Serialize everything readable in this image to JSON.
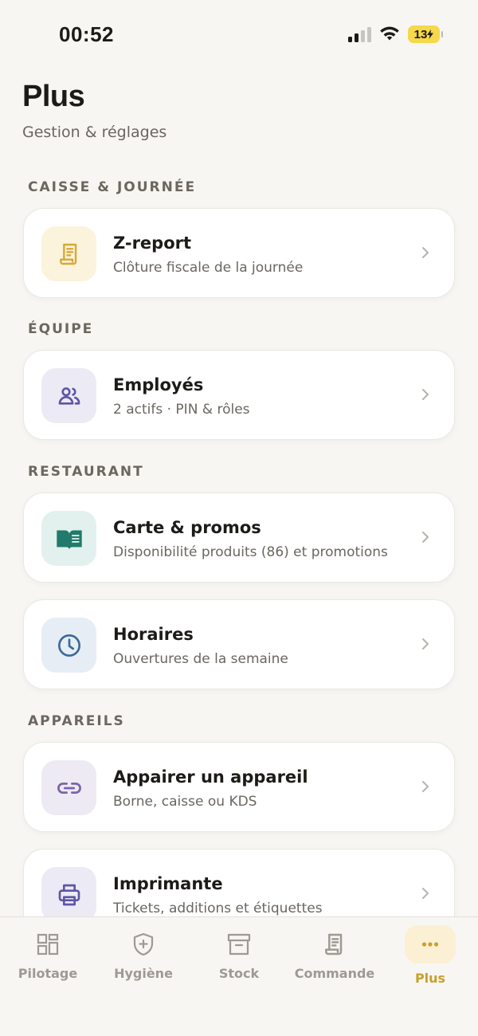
{
  "status_bar": {
    "time": "00:52",
    "battery": "13"
  },
  "header": {
    "title": "Plus",
    "subtitle": "Gestion & réglages"
  },
  "sections": {
    "caisse": "CAISSE & JOURNÉE",
    "equipe": "ÉQUIPE",
    "restaurant": "RESTAURANT",
    "appareils": "APPAREILS"
  },
  "items": {
    "zreport": {
      "title": "Z-report",
      "subtitle": "Clôture fiscale de la journée",
      "icon": "receipt-icon",
      "color": "#d6a935",
      "bg": "#fbf3dc"
    },
    "employes": {
      "title": "Employés",
      "subtitle": "2 actifs · PIN & rôles",
      "icon": "users-icon",
      "color": "#5f55a8",
      "bg": "#ecebf5"
    },
    "carte": {
      "title": "Carte & promos",
      "subtitle": "Disponibilité produits (86) et promotions",
      "icon": "book-icon",
      "color": "#217a6a",
      "bg": "#e2f1ed"
    },
    "horaires": {
      "title": "Horaires",
      "subtitle": "Ouvertures de la semaine",
      "icon": "clock-icon",
      "color": "#3b6a9b",
      "bg": "#e6edf4"
    },
    "appairer": {
      "title": "Appairer un appareil",
      "subtitle": "Borne, caisse ou KDS",
      "icon": "link-icon",
      "color": "#7c64ab",
      "bg": "#eeeaf4"
    },
    "imprimante": {
      "title": "Imprimante",
      "subtitle": "Tickets, additions et étiquettes",
      "icon": "printer-icon",
      "color": "#5f55a8",
      "bg": "#ecebf5"
    }
  },
  "tabs": [
    {
      "label": "Pilotage",
      "icon": "dashboard-icon"
    },
    {
      "label": "Hygiène",
      "icon": "shield-plus-icon"
    },
    {
      "label": "Stock",
      "icon": "archive-icon"
    },
    {
      "label": "Commande",
      "icon": "receipt-icon"
    },
    {
      "label": "Plus",
      "icon": "more-dots-icon",
      "active": true
    }
  ],
  "colors": {
    "accent": "#c8a02e",
    "background": "#f8f6f2",
    "muted": "#9e9a93"
  }
}
